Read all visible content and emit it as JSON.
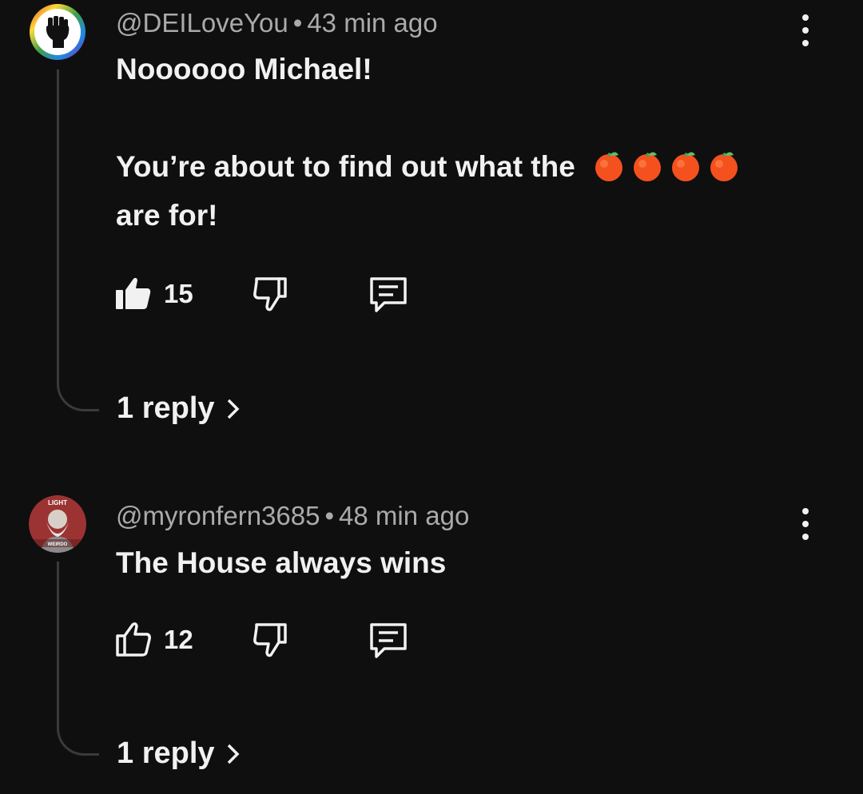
{
  "comments": [
    {
      "handle": "@DEILoveYou",
      "time": "43 min ago",
      "line1": "Noooooo Michael!",
      "line2": "You’re about to find out what the",
      "emoji_icons": [
        "tangerine-emoji",
        "tangerine-emoji",
        "tangerine-emoji",
        "tangerine-emoji"
      ],
      "line3": "are for!",
      "likes": "15",
      "liked": true,
      "replies": "1 reply"
    },
    {
      "handle": "@myronfern3685",
      "time": "48 min ago",
      "line1": "The House always wins",
      "likes": "12",
      "liked": false,
      "replies": "1 reply"
    }
  ],
  "avatar2": {
    "caption_top": "LIGHT",
    "caption_bottom": "WEIRDO"
  },
  "colors": {
    "background": "#0f0f0f",
    "text": "#f1f1f1",
    "meta": "#aaaaaa"
  }
}
